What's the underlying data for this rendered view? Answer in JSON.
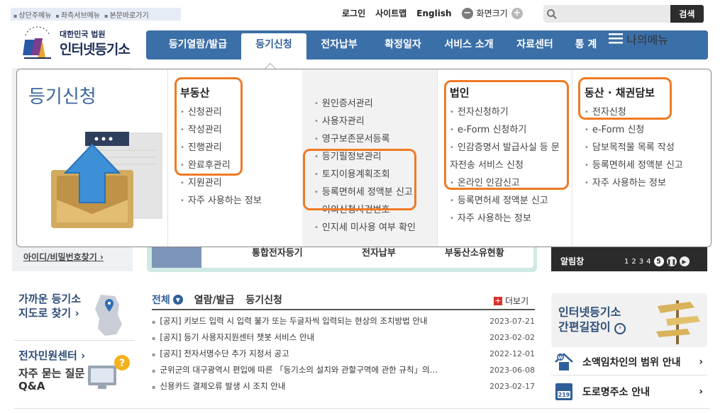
{
  "skip_links": [
    "상단주메뉴",
    "좌측서브메뉴",
    "본문바로가기"
  ],
  "util": {
    "login": "로그인",
    "sitemap": "사이트맵",
    "english": "English",
    "zoom_label": "화면크기",
    "zoom_out": "−",
    "zoom_in": "+"
  },
  "search": {
    "placeholder": "",
    "button": "검색"
  },
  "logo": {
    "small": "대한민국 법원",
    "big": "인터넷등기소",
    "seal_text": "대한민국법원"
  },
  "gnb": {
    "items": [
      "등기열람/발급",
      "등기신청",
      "전자납부",
      "확정일자",
      "서비스 소개",
      "자료센터",
      "통 계"
    ],
    "active": "등기신청",
    "mymenu": "나의메뉴"
  },
  "mega": {
    "title": "등기신청",
    "col1": {
      "head": "부동산",
      "items": [
        "신청관리",
        "작성관리",
        "진행관리",
        "완료후관리",
        "지원관리",
        "자주 사용하는 정보"
      ]
    },
    "col2": {
      "items": [
        "원인증서관리",
        "사용자관리",
        "영구보존문서등록",
        "등기필정보관리",
        "토지이용계획조회",
        "등록면허세 정액분 신고",
        "이의신청사건번호",
        "인지세 미사용 여부 확인"
      ]
    },
    "col3": {
      "head": "법인",
      "items": [
        "전자신청하기",
        "e-Form 신청하기",
        "인감증명서 발급사실 등 문자전송 서비스 신청",
        "온라인 인감신고",
        "등록면허세 정액분 신고",
        "자주 사용하는 정보"
      ]
    },
    "col4": {
      "head": "동산 · 채권담보",
      "items": [
        "전자신청",
        "e-Form 신청",
        "담보목적물 목록 작성",
        "등록면허세 정액분 신고",
        "자주 사용하는 정보"
      ]
    }
  },
  "main": {
    "id_find": "아이디/비밀번호찾기 ›",
    "quick_labels": [
      "통합전자등기",
      "전자납부",
      "부동산소유현황"
    ],
    "alarm": {
      "title": "알림창",
      "pages": [
        "1",
        "2",
        "3",
        "4"
      ],
      "current_page": "5"
    }
  },
  "lower": {
    "near_registry": [
      "가까운 등기소",
      "지도로 찾기 ›"
    ],
    "civil_center": "전자민원센터 ›",
    "faq": [
      "자주 묻는 질문",
      "Q&A"
    ],
    "tabs": [
      "전체",
      "열람/발급",
      "등기신청"
    ],
    "more": "더보기",
    "notices": [
      {
        "title": "[공지] 키보드 입력 시 입력 불가 또는 두글자씩 입력되는 현상의 조치방법 안내",
        "date": "2023-07-21"
      },
      {
        "title": "[공지] 등기 사용자지원센터 챗봇 서비스 안내",
        "date": "2023-02-02"
      },
      {
        "title": "[공지] 전자서명수단 추가 지정서 공고",
        "date": "2022-12-01"
      },
      {
        "title": "군위군의 대구광역시 편입에 따른 「등기소의 설치와 관할구역에 관한 규칙」의…",
        "date": "2023-06-08"
      },
      {
        "title": "신용카드 결제오류 발생 시 조치 안내",
        "date": "2023-02-17"
      }
    ],
    "banner": [
      "인터넷등기소",
      "간편길잡이"
    ],
    "links": [
      "소액임차인의 범위 안내",
      "도로명주소 안내"
    ],
    "road_badge": "219"
  },
  "colors": {
    "nav_blue": "#3b6fa8",
    "title_blue": "#3a67a0",
    "highlight_orange": "#f07a24"
  }
}
